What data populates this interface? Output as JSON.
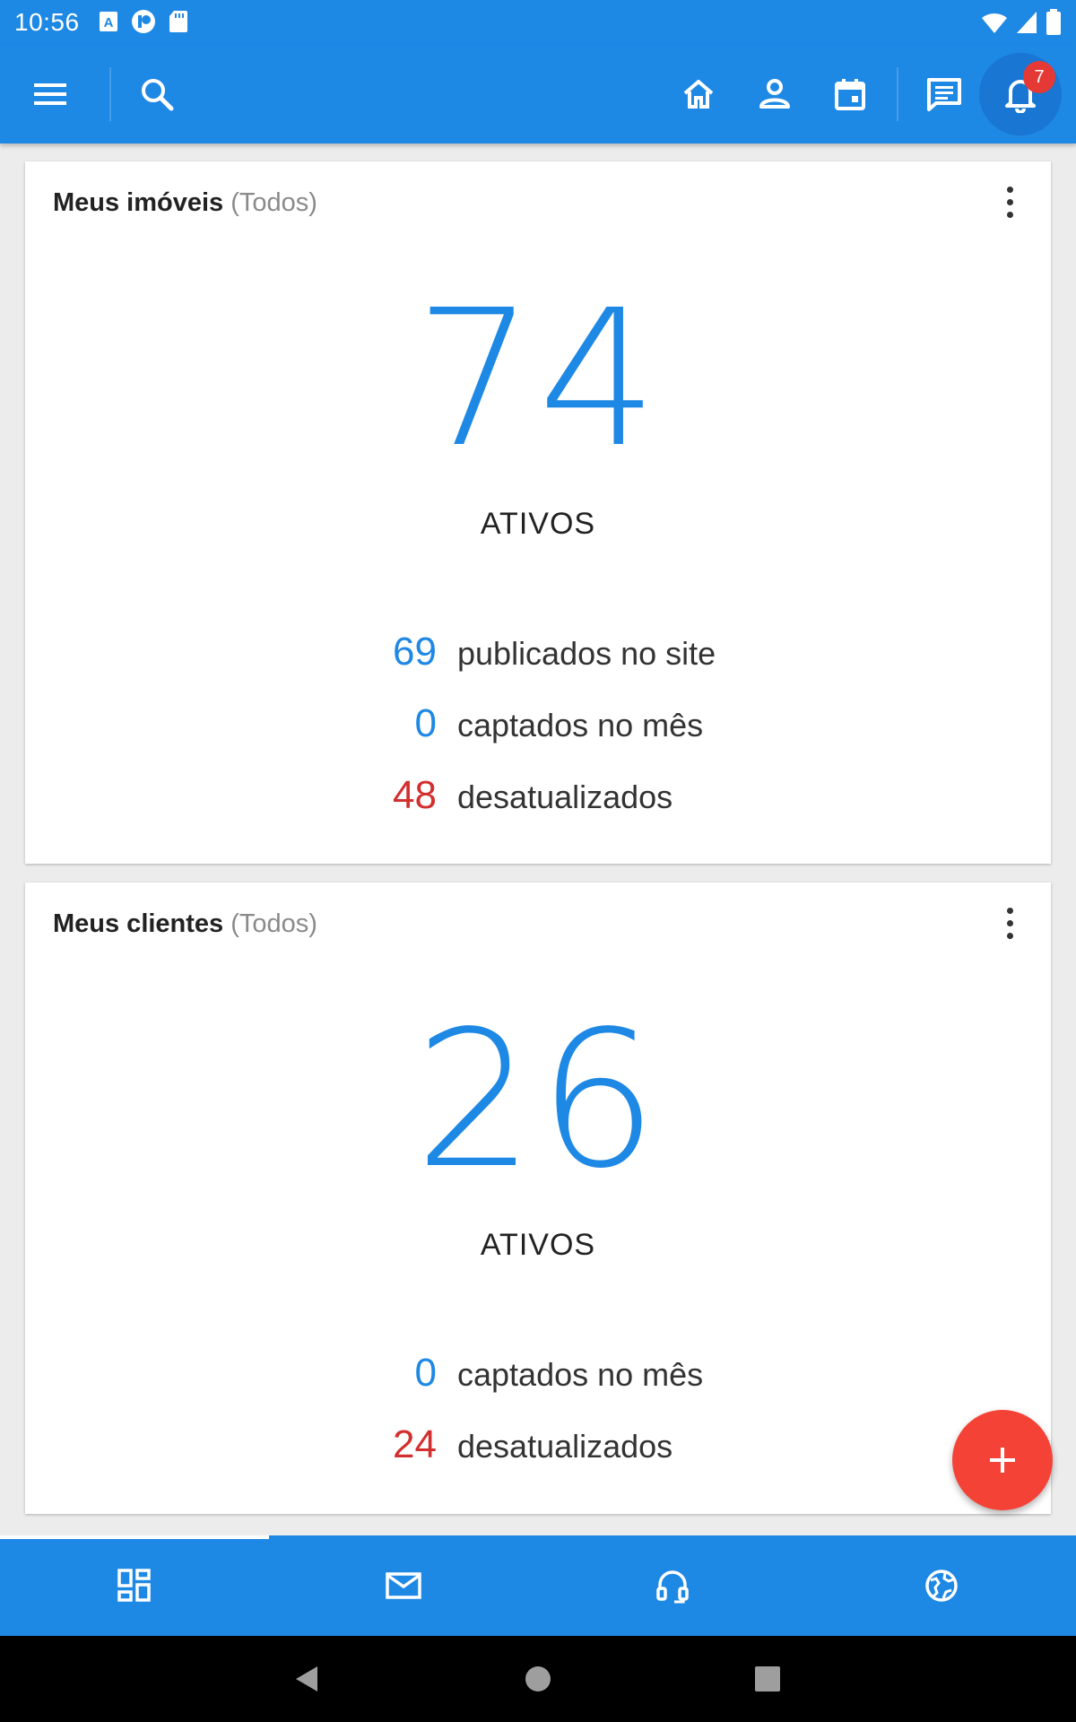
{
  "status_bar": {
    "time": "10:56",
    "icons": [
      "a-notification-icon",
      "app-notification-icon",
      "sd-card-icon",
      "wifi-icon",
      "signal-icon",
      "battery-icon"
    ]
  },
  "app_bar": {
    "color": "#1e88e5",
    "buttons": [
      "menu-icon",
      "search-icon",
      "home-icon",
      "person-icon",
      "calendar-icon",
      "chat-icon",
      "bell-icon"
    ],
    "notification_count": "7"
  },
  "cards": {
    "imoveis": {
      "title": "Meus imóveis",
      "subtitle": "(Todos)",
      "main_value": "74",
      "main_label": "ATIVOS",
      "stats": [
        {
          "value": "69",
          "label": "publicados no site",
          "color": "#1e88e5"
        },
        {
          "value": "0",
          "label": "captados no mês",
          "color": "#1e88e5"
        },
        {
          "value": "48",
          "label": "desatualizados",
          "color": "#d32f2f"
        }
      ]
    },
    "clientes": {
      "title": "Meus clientes",
      "subtitle": "(Todos)",
      "main_value": "26",
      "main_label": "ATIVOS",
      "stats": [
        {
          "value": "0",
          "label": "captados no mês",
          "color": "#1e88e5"
        },
        {
          "value": "24",
          "label": "desatualizados",
          "color": "#d32f2f"
        }
      ]
    }
  },
  "fab": {
    "icon": "plus-icon",
    "color": "#f44336"
  },
  "bottom_nav": {
    "items": [
      "dashboard-icon",
      "mail-icon",
      "headset-icon",
      "globe-icon"
    ],
    "selected": "dashboard-icon"
  },
  "system_nav": [
    "back-icon",
    "home-circle-icon",
    "recents-icon"
  ]
}
